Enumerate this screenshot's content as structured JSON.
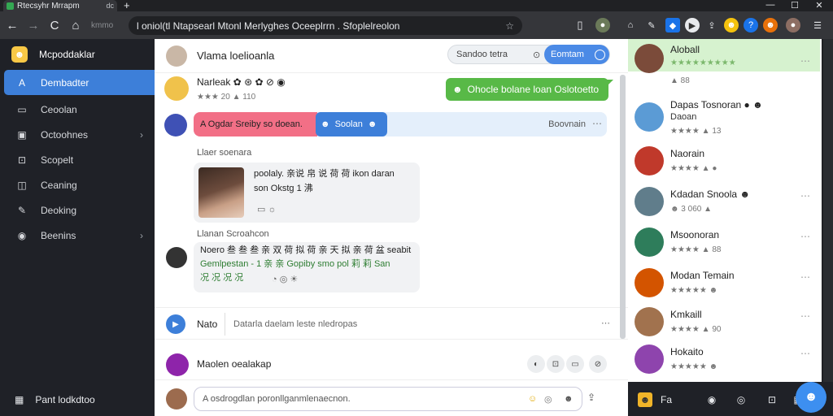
{
  "browser": {
    "tab_title": "Rtecsyhr Mrrapm",
    "tab_close": "dc",
    "new_tab": "+",
    "back": "←",
    "forward": "→",
    "reload": "C",
    "dim_text": "kmmo",
    "address": "l oniol(tl Ntapsearl Mtonl Merlyghes Oceeplrrn . Sfoplelreolon",
    "star": "☆",
    "window_min": "—",
    "window_max": "☐",
    "window_close": "✕"
  },
  "sidebar": {
    "brand": "Mcpoddaklar",
    "items": [
      {
        "label": "Dembadter",
        "icon": "A"
      },
      {
        "label": "Ceoolan",
        "icon": "▭"
      },
      {
        "label": "Octoohnes",
        "icon": "▣"
      },
      {
        "label": "Scopelt",
        "icon": "⊡"
      },
      {
        "label": "Ceaning",
        "icon": "◫"
      },
      {
        "label": "Deoking",
        "icon": "✎"
      },
      {
        "label": "Beenins",
        "icon": "◉"
      }
    ],
    "caret": "›",
    "bottom_label": "Pant lodkdtoo",
    "bottom_icon": "▦"
  },
  "main": {
    "title": "Vlama loelioanla",
    "search_placeholder": "Sandoo tetra",
    "search_icon": "⊙",
    "search_button": "Eomtam",
    "post": {
      "name": "Narleak ✿ ⊛ ✿ ⊘ ◉",
      "meta": "★★★ 20 ▲ 110"
    },
    "green_pill": "Ohocle bolane loan Oslotoetto",
    "bar": {
      "pink_text": "A Ogdar Sreiby so doean.",
      "blue_text": "Soolan",
      "right_text": "Boovnain",
      "dots": "⋯"
    },
    "section1_label": "Llaer soenara",
    "card1_text1": "poolaly. 亲说 帛 说 荷 荷 ikon daran",
    "card1_text2": "son Okstg 1 沸",
    "card1_meta": "▭ ☼",
    "section2_label": "Llanan Scroahcon",
    "card2_text1": "Noero 叁 叁 叁 亲 双 荷 拟 荷 亲 天 拟 亲 荷 盆 seabit",
    "card2_text2": "Gemlpestan - 1 亲 亲 Gopiby smo pol 莉 莉 San",
    "card2_text3": "况 况 况 况",
    "card2_meta": "◔ ◎ ☀",
    "compose_label": "Nato",
    "compose_placeholder": "Datarla daelam leste nledropas",
    "compose_more": "⋯",
    "thread_name": "Maolen oealakap",
    "thread_icons": [
      "◐",
      "⊡",
      "▭",
      "⊘"
    ],
    "reply_placeholder": "A osdrogdlan poronllganmlenaecnon.",
    "reply_icons": [
      "☺",
      "◎",
      "☻"
    ],
    "reply_send": "⇪"
  },
  "right_panel": {
    "top_name": "Aloball",
    "top_stars": "★★★★★★★★★",
    "top_meta": "▲ 88",
    "contacts": [
      {
        "name": "Dapas Tosnoran ● ☻",
        "sub": "Daoan",
        "meta": "★★★★ ▲ 13"
      },
      {
        "name": "Naorain",
        "meta": "★★★★ ▲ ●"
      },
      {
        "name": "Kdadan Snoola ☻",
        "meta": "☻ 3 060 ▲"
      },
      {
        "name": "Msoonoran",
        "meta": "★★★★ ▲ 88"
      },
      {
        "name": "Modan Temain",
        "meta": "★★★★★ ☻"
      },
      {
        "name": "Kmkaill",
        "meta": "★★★★ ▲ 90"
      },
      {
        "name": "Hokaito",
        "meta": "★★★★★ ☻"
      }
    ],
    "dots": "⋯"
  },
  "bottom_bar": {
    "items": [
      "☻",
      "Fa",
      "◉",
      "◎",
      "⊡",
      "▦"
    ],
    "fab_icon": "☻"
  },
  "colors": {
    "accent_blue": "#3d7fd9",
    "green": "#58b947",
    "pink": "#f26f86",
    "sidebar_bg": "#1f2127"
  }
}
